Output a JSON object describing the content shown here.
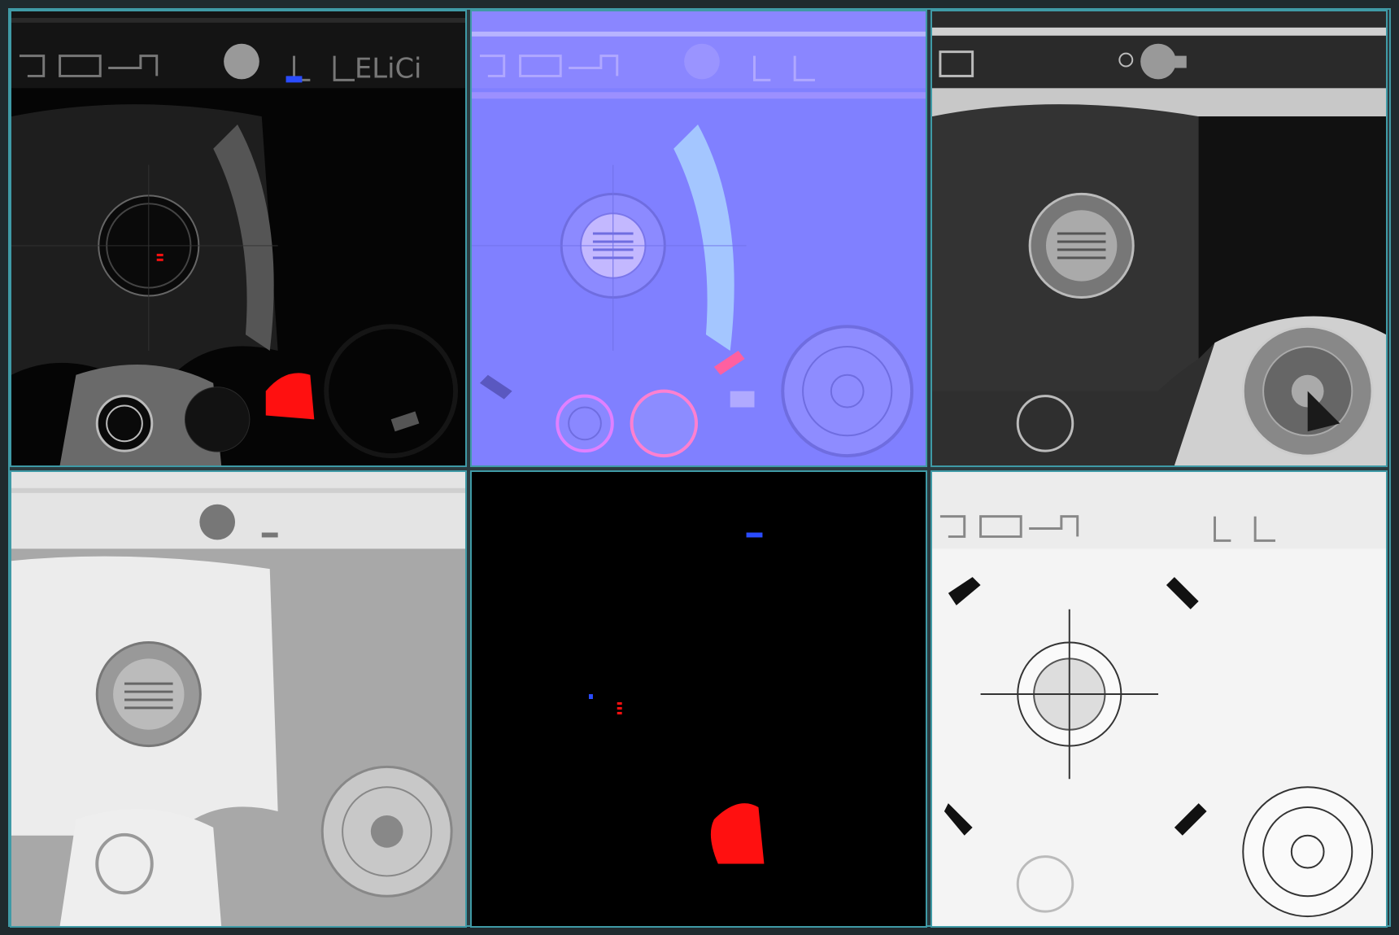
{
  "sheet": {
    "title": "",
    "tiles": [
      {
        "name": "emissive-map-tile",
        "kind": "base-color-emissive"
      },
      {
        "name": "normal-map-tile",
        "kind": "normal"
      },
      {
        "name": "roughness-map-tile",
        "kind": "roughness"
      },
      {
        "name": "height-map-tile",
        "kind": "height"
      },
      {
        "name": "emission-mask-tile",
        "kind": "emission-mask"
      },
      {
        "name": "ambient-occlusion-tile",
        "kind": "ambient-occlusion"
      }
    ],
    "panel_strip_text": "ELiCi",
    "colors": {
      "frame": "#3f9aa6",
      "normal_base": "#8080ff",
      "emissive_red": "#ff1010",
      "emissive_blue": "#2a4cff"
    }
  }
}
